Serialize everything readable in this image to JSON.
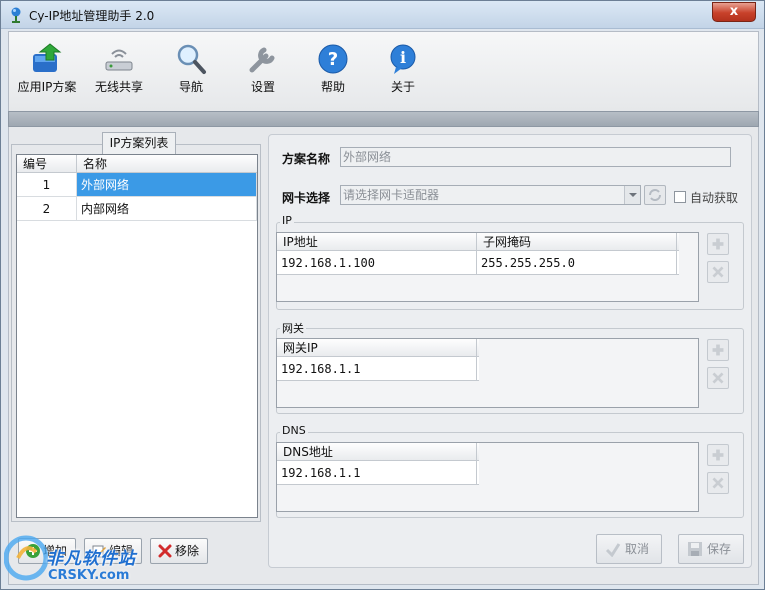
{
  "window": {
    "title": "Cy-IP地址管理助手 2.0",
    "close": "x"
  },
  "toolbar": {
    "items": [
      {
        "label": "应用IP方案",
        "icon": "apply-ip-icon"
      },
      {
        "label": "无线共享",
        "icon": "wireless-icon"
      },
      {
        "label": "导航",
        "icon": "magnifier-icon"
      },
      {
        "label": "设置",
        "icon": "wrench-icon"
      },
      {
        "label": "帮助",
        "icon": "help-icon"
      },
      {
        "label": "关于",
        "icon": "info-icon"
      }
    ]
  },
  "scheme_list": {
    "tab": "IP方案列表",
    "columns": [
      "编号",
      "名称"
    ],
    "rows": [
      {
        "id": "1",
        "name": "外部网络",
        "selected": true
      },
      {
        "id": "2",
        "name": "内部网络",
        "selected": false
      }
    ],
    "buttons": {
      "add": "增加",
      "edit": "编辑",
      "remove": "移除"
    }
  },
  "details": {
    "scheme_name_label": "方案名称",
    "scheme_name_value": "外部网络",
    "nic_label": "网卡选择",
    "nic_placeholder": "请选择网卡适配器",
    "auto_obtain": "自动获取",
    "ip_group": {
      "title": "IP",
      "columns": [
        "IP地址",
        "子网掩码"
      ],
      "rows": [
        {
          "ip": "192.168.1.100",
          "mask": "255.255.255.0"
        }
      ]
    },
    "gateway_group": {
      "title": "网关",
      "columns": [
        "网关IP"
      ],
      "rows": [
        {
          "ip": "192.168.1.1"
        }
      ]
    },
    "dns_group": {
      "title": "DNS",
      "columns": [
        "DNS地址"
      ],
      "rows": [
        {
          "ip": "192.168.1.1"
        }
      ]
    },
    "cancel": "取消",
    "save": "保存"
  },
  "watermark": {
    "text": "非凡软件站",
    "sub": "CRSKY.com"
  },
  "colors": {
    "selection": "#3b9ae6",
    "titlebar": "#c3d4e7",
    "close": "#c8412a"
  }
}
